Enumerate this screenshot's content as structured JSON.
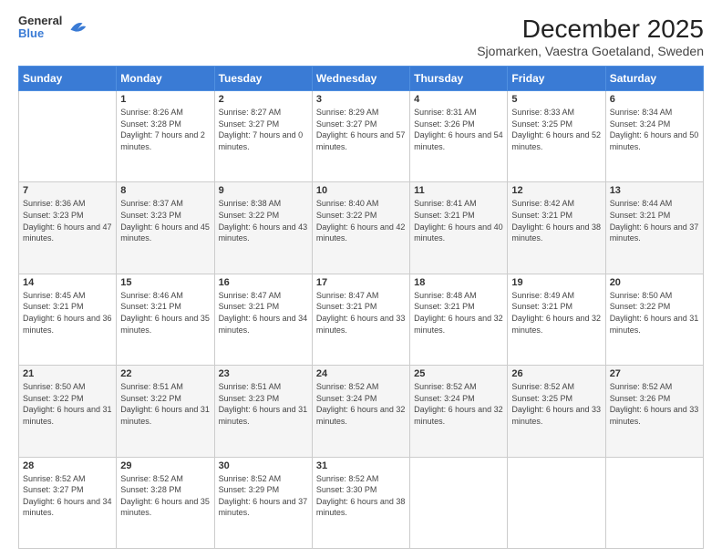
{
  "logo": {
    "general": "General",
    "blue": "Blue"
  },
  "title": "December 2025",
  "subtitle": "Sjomarken, Vaestra Goetaland, Sweden",
  "weekdays": [
    "Sunday",
    "Monday",
    "Tuesday",
    "Wednesday",
    "Thursday",
    "Friday",
    "Saturday"
  ],
  "weeks": [
    [
      {
        "day": "",
        "sunrise": "",
        "sunset": "",
        "daylight": ""
      },
      {
        "day": "1",
        "sunrise": "Sunrise: 8:26 AM",
        "sunset": "Sunset: 3:28 PM",
        "daylight": "Daylight: 7 hours and 2 minutes."
      },
      {
        "day": "2",
        "sunrise": "Sunrise: 8:27 AM",
        "sunset": "Sunset: 3:27 PM",
        "daylight": "Daylight: 7 hours and 0 minutes."
      },
      {
        "day": "3",
        "sunrise": "Sunrise: 8:29 AM",
        "sunset": "Sunset: 3:27 PM",
        "daylight": "Daylight: 6 hours and 57 minutes."
      },
      {
        "day": "4",
        "sunrise": "Sunrise: 8:31 AM",
        "sunset": "Sunset: 3:26 PM",
        "daylight": "Daylight: 6 hours and 54 minutes."
      },
      {
        "day": "5",
        "sunrise": "Sunrise: 8:33 AM",
        "sunset": "Sunset: 3:25 PM",
        "daylight": "Daylight: 6 hours and 52 minutes."
      },
      {
        "day": "6",
        "sunrise": "Sunrise: 8:34 AM",
        "sunset": "Sunset: 3:24 PM",
        "daylight": "Daylight: 6 hours and 50 minutes."
      }
    ],
    [
      {
        "day": "7",
        "sunrise": "Sunrise: 8:36 AM",
        "sunset": "Sunset: 3:23 PM",
        "daylight": "Daylight: 6 hours and 47 minutes."
      },
      {
        "day": "8",
        "sunrise": "Sunrise: 8:37 AM",
        "sunset": "Sunset: 3:23 PM",
        "daylight": "Daylight: 6 hours and 45 minutes."
      },
      {
        "day": "9",
        "sunrise": "Sunrise: 8:38 AM",
        "sunset": "Sunset: 3:22 PM",
        "daylight": "Daylight: 6 hours and 43 minutes."
      },
      {
        "day": "10",
        "sunrise": "Sunrise: 8:40 AM",
        "sunset": "Sunset: 3:22 PM",
        "daylight": "Daylight: 6 hours and 42 minutes."
      },
      {
        "day": "11",
        "sunrise": "Sunrise: 8:41 AM",
        "sunset": "Sunset: 3:21 PM",
        "daylight": "Daylight: 6 hours and 40 minutes."
      },
      {
        "day": "12",
        "sunrise": "Sunrise: 8:42 AM",
        "sunset": "Sunset: 3:21 PM",
        "daylight": "Daylight: 6 hours and 38 minutes."
      },
      {
        "day": "13",
        "sunrise": "Sunrise: 8:44 AM",
        "sunset": "Sunset: 3:21 PM",
        "daylight": "Daylight: 6 hours and 37 minutes."
      }
    ],
    [
      {
        "day": "14",
        "sunrise": "Sunrise: 8:45 AM",
        "sunset": "Sunset: 3:21 PM",
        "daylight": "Daylight: 6 hours and 36 minutes."
      },
      {
        "day": "15",
        "sunrise": "Sunrise: 8:46 AM",
        "sunset": "Sunset: 3:21 PM",
        "daylight": "Daylight: 6 hours and 35 minutes."
      },
      {
        "day": "16",
        "sunrise": "Sunrise: 8:47 AM",
        "sunset": "Sunset: 3:21 PM",
        "daylight": "Daylight: 6 hours and 34 minutes."
      },
      {
        "day": "17",
        "sunrise": "Sunrise: 8:47 AM",
        "sunset": "Sunset: 3:21 PM",
        "daylight": "Daylight: 6 hours and 33 minutes."
      },
      {
        "day": "18",
        "sunrise": "Sunrise: 8:48 AM",
        "sunset": "Sunset: 3:21 PM",
        "daylight": "Daylight: 6 hours and 32 minutes."
      },
      {
        "day": "19",
        "sunrise": "Sunrise: 8:49 AM",
        "sunset": "Sunset: 3:21 PM",
        "daylight": "Daylight: 6 hours and 32 minutes."
      },
      {
        "day": "20",
        "sunrise": "Sunrise: 8:50 AM",
        "sunset": "Sunset: 3:22 PM",
        "daylight": "Daylight: 6 hours and 31 minutes."
      }
    ],
    [
      {
        "day": "21",
        "sunrise": "Sunrise: 8:50 AM",
        "sunset": "Sunset: 3:22 PM",
        "daylight": "Daylight: 6 hours and 31 minutes."
      },
      {
        "day": "22",
        "sunrise": "Sunrise: 8:51 AM",
        "sunset": "Sunset: 3:22 PM",
        "daylight": "Daylight: 6 hours and 31 minutes."
      },
      {
        "day": "23",
        "sunrise": "Sunrise: 8:51 AM",
        "sunset": "Sunset: 3:23 PM",
        "daylight": "Daylight: 6 hours and 31 minutes."
      },
      {
        "day": "24",
        "sunrise": "Sunrise: 8:52 AM",
        "sunset": "Sunset: 3:24 PM",
        "daylight": "Daylight: 6 hours and 32 minutes."
      },
      {
        "day": "25",
        "sunrise": "Sunrise: 8:52 AM",
        "sunset": "Sunset: 3:24 PM",
        "daylight": "Daylight: 6 hours and 32 minutes."
      },
      {
        "day": "26",
        "sunrise": "Sunrise: 8:52 AM",
        "sunset": "Sunset: 3:25 PM",
        "daylight": "Daylight: 6 hours and 33 minutes."
      },
      {
        "day": "27",
        "sunrise": "Sunrise: 8:52 AM",
        "sunset": "Sunset: 3:26 PM",
        "daylight": "Daylight: 6 hours and 33 minutes."
      }
    ],
    [
      {
        "day": "28",
        "sunrise": "Sunrise: 8:52 AM",
        "sunset": "Sunset: 3:27 PM",
        "daylight": "Daylight: 6 hours and 34 minutes."
      },
      {
        "day": "29",
        "sunrise": "Sunrise: 8:52 AM",
        "sunset": "Sunset: 3:28 PM",
        "daylight": "Daylight: 6 hours and 35 minutes."
      },
      {
        "day": "30",
        "sunrise": "Sunrise: 8:52 AM",
        "sunset": "Sunset: 3:29 PM",
        "daylight": "Daylight: 6 hours and 37 minutes."
      },
      {
        "day": "31",
        "sunrise": "Sunrise: 8:52 AM",
        "sunset": "Sunset: 3:30 PM",
        "daylight": "Daylight: 6 hours and 38 minutes."
      },
      {
        "day": "",
        "sunrise": "",
        "sunset": "",
        "daylight": ""
      },
      {
        "day": "",
        "sunrise": "",
        "sunset": "",
        "daylight": ""
      },
      {
        "day": "",
        "sunrise": "",
        "sunset": "",
        "daylight": ""
      }
    ]
  ]
}
